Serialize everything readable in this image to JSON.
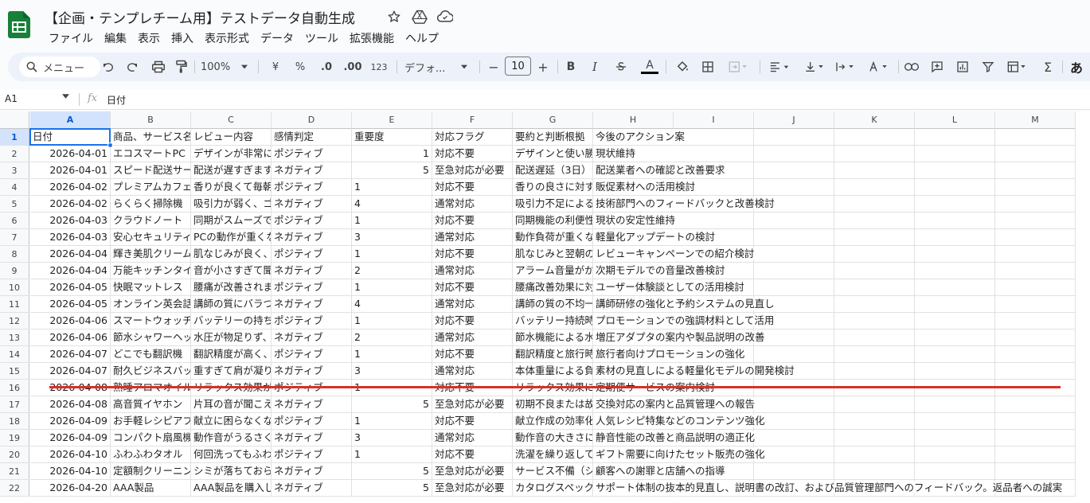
{
  "doc": {
    "title": "【企画・テンプレチーム用】テストデータ自動生成",
    "star_icon": "star-icon",
    "move_icon": "move-to-drive-icon",
    "cloud_icon": "cloud-saved-icon"
  },
  "menu": [
    "ファイル",
    "編集",
    "表示",
    "挿入",
    "表示形式",
    "データ",
    "ツール",
    "拡張機能",
    "ヘルプ"
  ],
  "toolbar": {
    "search_placeholder": "メニュー",
    "zoom": "100%",
    "currency": "¥",
    "percent": "%",
    "dec_decrease": ".0",
    "dec_increase": ".00",
    "number_format": "123",
    "font": "デフォ...",
    "font_size": "10",
    "minus": "−",
    "plus": "+",
    "bold": "B",
    "italic": "I",
    "text_color": "A",
    "sigma": "Σ",
    "input_tools": "あ"
  },
  "formula_bar": {
    "cell_ref": "A1",
    "fx": "fx",
    "content": "日付"
  },
  "columns": [
    "A",
    "B",
    "C",
    "D",
    "E",
    "F",
    "G",
    "H",
    "I",
    "J",
    "K",
    "L",
    "M"
  ],
  "header_row": [
    "日付",
    "商品、サービス名",
    "レビュー内容",
    "感情判定",
    "重要度",
    "対応フラグ",
    "要約と判断根拠",
    "今後のアクション案"
  ],
  "rows": [
    [
      "2026-04-01",
      "エコスマートPC",
      "デザインが非常に",
      "ポジティブ",
      "1",
      "対応不要",
      "デザインと使い勝",
      "現状維持"
    ],
    [
      "2026-04-01",
      "スピード配送サービス",
      "配送が遅すぎます",
      "ネガティブ",
      "5",
      "至急対応が必要",
      "配送遅延（3日）",
      "配送業者への確認と改善要求"
    ],
    [
      "2026-04-02",
      "プレミアムカフェ",
      "香りが良くて毎朝",
      "ポジティブ",
      "1",
      "対応不要",
      "香りの良さに対す",
      "販促素材への活用検討"
    ],
    [
      "2026-04-02",
      "らくらく掃除機",
      "吸引力が弱く、ゴ",
      "ネガティブ",
      "4",
      "通常対応",
      "吸引力不足による",
      "技術部門へのフィードバックと改善検討"
    ],
    [
      "2026-04-03",
      "クラウドノート",
      "同期がスムーズで",
      "ポジティブ",
      "1",
      "対応不要",
      "同期機能の利便性",
      "現状の安定性維持"
    ],
    [
      "2026-04-03",
      "安心セキュリティ",
      "PCの動作が重くな",
      "ネガティブ",
      "3",
      "通常対応",
      "動作負荷が重くな",
      "軽量化アップデートの検討"
    ],
    [
      "2026-04-04",
      "輝き美肌クリーム",
      "肌なじみが良く、",
      "ポジティブ",
      "1",
      "対応不要",
      "肌なじみと翌朝の",
      "レビューキャンペーンでの紹介検討"
    ],
    [
      "2026-04-04",
      "万能キッチンタイマー",
      "音が小さすぎて聞",
      "ネガティブ",
      "2",
      "通常対応",
      "アラーム音量がか",
      "次期モデルでの音量改善検討"
    ],
    [
      "2026-04-05",
      "快眠マットレス",
      "腰痛が改善されま",
      "ポジティブ",
      "1",
      "対応不要",
      "腰痛改善効果に対",
      "ユーザー体験談としての活用検討"
    ],
    [
      "2026-04-05",
      "オンライン英会話",
      "講師の質にバラつ",
      "ネガティブ",
      "4",
      "通常対応",
      "講師の質の不均一",
      "講師研修の強化と予約システムの見直し"
    ],
    [
      "2026-04-06",
      "スマートウォッチ",
      "バッテリーの持ち",
      "ポジティブ",
      "1",
      "対応不要",
      "バッテリー持続時",
      "プロモーションでの強調材料として活用"
    ],
    [
      "2026-04-06",
      "節水シャワーヘッド",
      "水圧が物足りず、",
      "ネガティブ",
      "2",
      "通常対応",
      "節水機能による水",
      "増圧アダプタの案内や製品説明の改善"
    ],
    [
      "2026-04-07",
      "どこでも翻訳機",
      "翻訳精度が高く、",
      "ポジティブ",
      "1",
      "対応不要",
      "翻訳精度と旅行時",
      "旅行者向けプロモーションの強化"
    ],
    [
      "2026-04-07",
      "耐久ビジネスバッグ",
      "重すぎて肩が凝り",
      "ネガティブ",
      "3",
      "通常対応",
      "本体重量による負",
      "素材の見直しによる軽量化モデルの開発検討"
    ],
    [
      "2026-04-08",
      "熟睡アロマオイル",
      "リラックス効果が",
      "ポジティブ",
      "1",
      "対応不要",
      "リラックス効果に",
      "定期便サービスの案内検討"
    ],
    [
      "2026-04-08",
      "高音質イヤホン",
      "片耳の音が聞こえ",
      "ネガティブ",
      "5",
      "至急対応が必要",
      "初期不良または故",
      "交換対応の案内と品質管理への報告"
    ],
    [
      "2026-04-09",
      "お手軽レシピアプリ",
      "献立に困らなくな",
      "ポジティブ",
      "1",
      "対応不要",
      "献立作成の効率化",
      "人気レシピ特集などのコンテンツ強化"
    ],
    [
      "2026-04-09",
      "コンパクト扇風機",
      "動作音がうるさく",
      "ネガティブ",
      "3",
      "通常対応",
      "動作音の大きさに",
      "静音性能の改善と商品説明の適正化"
    ],
    [
      "2026-04-10",
      "ふわふわタオル",
      "何回洗ってもふわ",
      "ポジティブ",
      "1",
      "対応不要",
      "洗濯を繰り返して",
      "ギフト需要に向けたセット販売の強化"
    ],
    [
      "2026-04-10",
      "定額制クリーニング",
      "シミが落ちておら",
      "ネガティブ",
      "5",
      "至急対応が必要",
      "サービス不備（シ",
      "顧客への謝罪と店舗への指導"
    ],
    [
      "2026-04-20",
      "AAA製品",
      "AAA製品を購入し",
      "ネガティブ",
      "5",
      "至急対応が必要",
      "カタログスペック",
      "サポート体制の抜本的見直し、説明書の改訂、および品質管理部門へのフィードバック。返品者への誠実"
    ]
  ],
  "colors": {
    "accent": "#1a73e8",
    "sheets_green": "#188038",
    "underline_red": "#d93025"
  }
}
